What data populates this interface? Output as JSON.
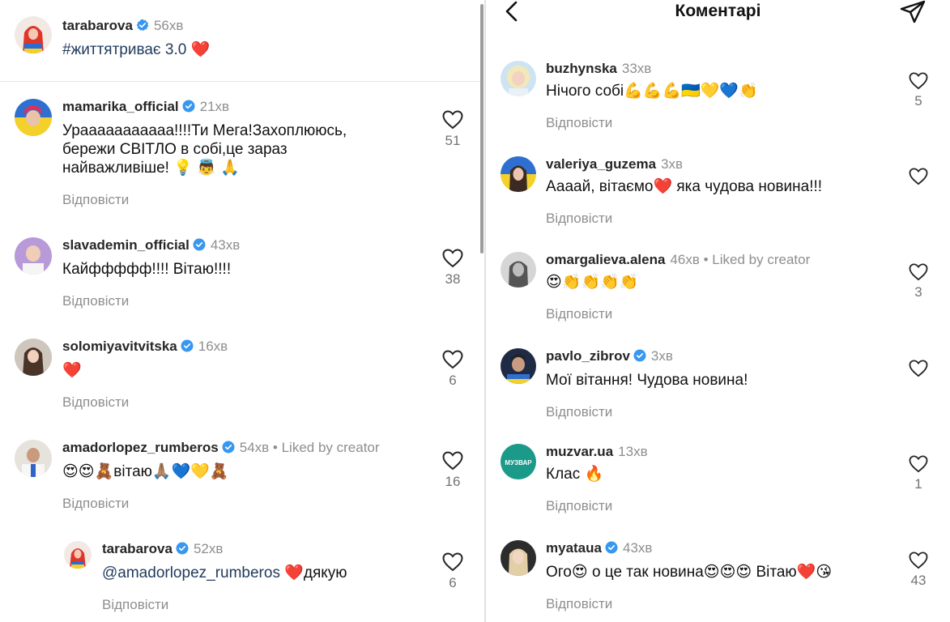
{
  "left": {
    "caption": {
      "username": "tarabarova",
      "time": "56хв",
      "text": "#життятриває 3.0 ❤️"
    },
    "comments": [
      {
        "username": "mamarika_official",
        "time": "21хв",
        "liked_by_creator": "",
        "lines": [
          "Урааааааааааа!!!!Ти Мега!Захоплююсь,",
          "бережи СВІТЛО в собі,це зараз",
          "найважливіше! 💡 👼 🙏"
        ],
        "reply": "Відповісти",
        "likes": "51"
      },
      {
        "username": "slavademin_official",
        "time": "43хв",
        "liked_by_creator": "",
        "lines": [
          "Кайффффф!!!! Вітаю!!!!"
        ],
        "reply": "Відповісти",
        "likes": "38"
      },
      {
        "username": "solomiyavitvitska",
        "time": "16хв",
        "liked_by_creator": "",
        "lines": [
          "❤️"
        ],
        "reply": "Відповісти",
        "likes": "6"
      },
      {
        "username": "amadorlopez_rumberos",
        "time": "54хв",
        "liked_by_creator": "• Liked by creator",
        "lines": [
          "😍😍🧸вітаю🙏🏽💙💛🧸"
        ],
        "reply": "Відповісти",
        "likes": "16"
      }
    ],
    "nested_reply": {
      "username": "tarabarova",
      "time": "52хв",
      "mention": "@amadorlopez_rumberos",
      "text": " ❤️дякую",
      "reply": "Відповісти",
      "likes": "6"
    }
  },
  "right": {
    "header": {
      "title": "Коментарі"
    },
    "comments": [
      {
        "username": "buzhynska",
        "verified": false,
        "time": "33хв",
        "liked_by_creator": "",
        "text": "Нічого собі💪💪💪🇺🇦💛💙👏",
        "reply": "Відповісти",
        "likes": "5"
      },
      {
        "username": "valeriya_guzema",
        "verified": false,
        "time": "3хв",
        "liked_by_creator": "",
        "text": "Аааай, вітаємо❤️ яка чудова новина!!!",
        "reply": "Відповісти",
        "likes": ""
      },
      {
        "username": "omargalieva.alena",
        "verified": false,
        "time": "46хв",
        "liked_by_creator": "• Liked by creator",
        "text": "😍👏👏👏👏",
        "reply": "Відповісти",
        "likes": "3"
      },
      {
        "username": "pavlo_zibrov",
        "verified": true,
        "time": "3хв",
        "liked_by_creator": "",
        "text": "Мої вітання! Чудова новина!",
        "reply": "Відповісти",
        "likes": ""
      },
      {
        "username": "muzvar.ua",
        "verified": false,
        "time": "13хв",
        "liked_by_creator": "",
        "text": "Клас 🔥",
        "reply": "Відповісти",
        "likes": "1"
      },
      {
        "username": "myataua",
        "verified": true,
        "time": "43хв",
        "liked_by_creator": "",
        "text": "Ого😍 о це так новина😍😍😍 Вітаю❤️😘",
        "reply": "Відповісти",
        "likes": "43"
      }
    ],
    "muzvar_logo_text": "МУЗВАР"
  },
  "colors": {
    "verified": "#3897f0",
    "muted": "#8e8e8e",
    "mention": "#1f3a5c"
  },
  "icons": {
    "verified": "verified-badge-icon",
    "heart": "heart-outline-icon",
    "back": "chevron-left-icon",
    "send": "paper-plane-icon"
  }
}
